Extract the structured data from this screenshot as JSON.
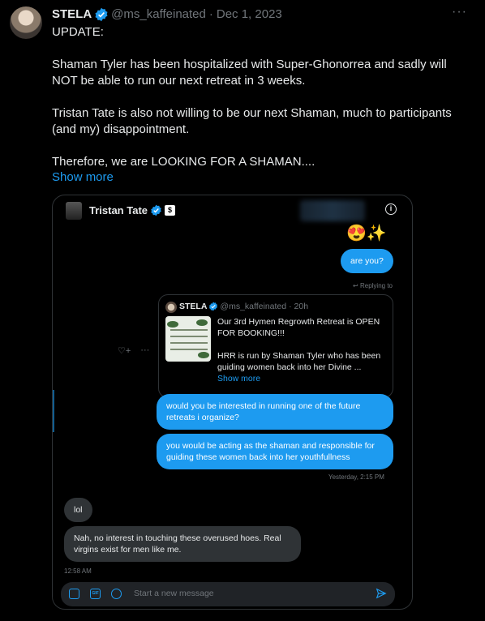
{
  "tweet": {
    "author_name": "STELA",
    "handle": "@ms_kaffeinated",
    "separator": "·",
    "date": "Dec 1, 2023",
    "text": "UPDATE:\n\nShaman Tyler has been hospitalized with Super-Ghonorrea and sadly will NOT be able to run our next retreat in 3 weeks.\n\nTristan Tate is also not willing to be our next Shaman, much to participants (and my) disappointment.\n\nTherefore, we are LOOKING FOR A SHAMAN....",
    "show_more": "Show more",
    "more_icon": "···"
  },
  "dm": {
    "contact_name": "Tristan Tate",
    "info_icon": "i",
    "badge_icon": "$",
    "emoji": "😍✨",
    "msg_are_you": "are you?",
    "replying_to": "↩ Replying to",
    "quote": {
      "author_name": "STELA",
      "handle": "@ms_kaffeinated",
      "time": "· 20h",
      "text": "Our 3rd Hymen Regrowth Retreat is OPEN FOR BOOKING!!!\n\nHRR is run by Shaman Tyler who has been guiding women back into her Divine ...",
      "show_more": "Show more"
    },
    "side_icons": [
      "♡+",
      "···"
    ],
    "msg_interest": "would you be interested in running one of the future retreats i organize?",
    "msg_shaman": "you would be acting as the shaman and responsible for guiding these women back into her youthfullness",
    "timestamp_1": "Yesterday, 2:15 PM",
    "msg_lol": "lol",
    "msg_reply": "Nah, no interest in touching these overused hoes. Real virgins exist for men like me.",
    "timestamp_2": "12:58 AM",
    "composer_placeholder": "Start a new message",
    "composer_gif": "GIF"
  },
  "colors": {
    "accent": "#1d9bf0",
    "background": "#000000",
    "bubble_gray": "#2f3336",
    "muted_text": "#71767b"
  }
}
